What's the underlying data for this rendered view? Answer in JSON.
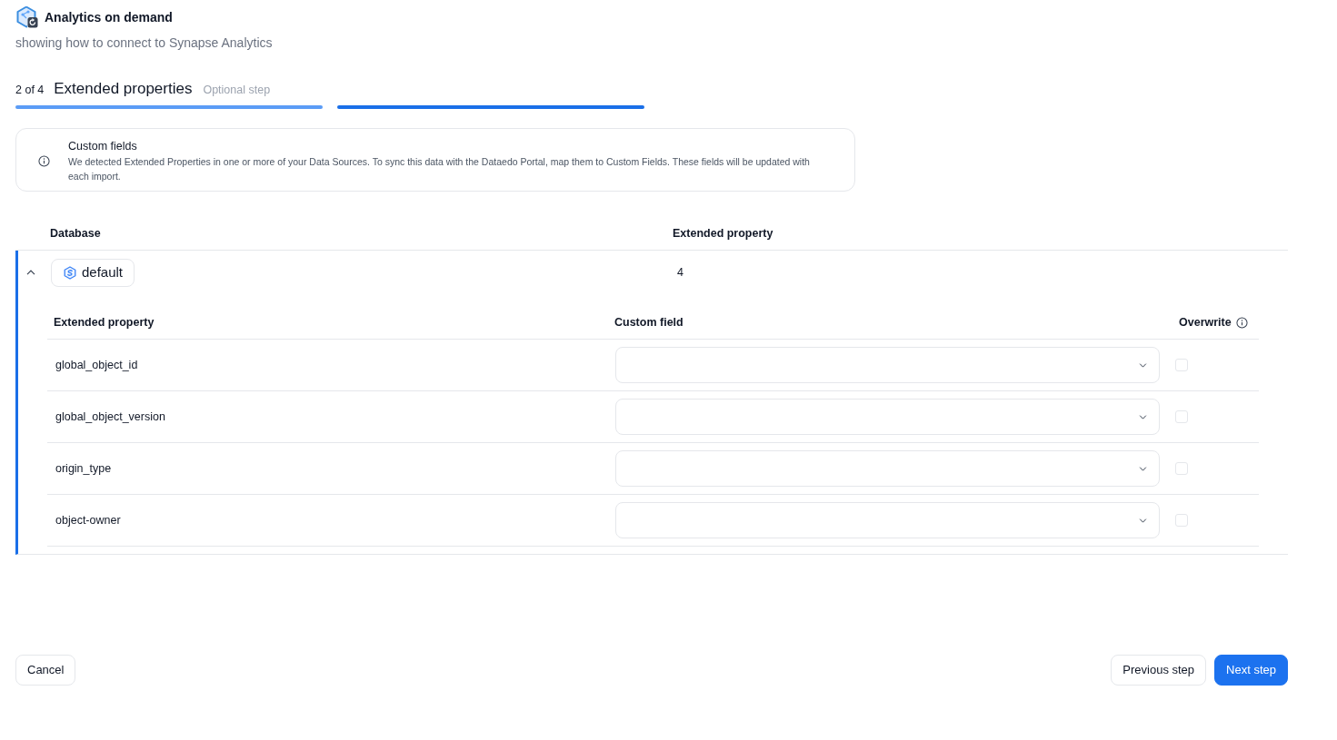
{
  "header": {
    "title": "Analytics on demand",
    "subtitle": "showing how to connect to Synapse Analytics"
  },
  "step": {
    "counter": "2 of 4",
    "title": "Extended properties",
    "note": "Optional step",
    "segments": [
      {
        "kind": "completed"
      },
      {
        "kind": "current"
      }
    ]
  },
  "notice": {
    "title": "Custom fields",
    "text": "We detected Extended Properties in one or more of your Data Sources. To sync this data with the Dataedo Portal, map them to Custom Fields. These fields will be updated with each import."
  },
  "table": {
    "columns": [
      "Database",
      "Extended property"
    ],
    "groups": [
      {
        "name": "default",
        "count": "4",
        "expanded": true,
        "columns": [
          {
            "label": "Extended property",
            "info": false
          },
          {
            "label": "Custom field",
            "info": false
          },
          {
            "label": "Overwrite",
            "info": true
          }
        ],
        "rows": [
          {
            "property": "global_object_id",
            "overwrite": false
          },
          {
            "property": "global_object_version",
            "overwrite": false
          },
          {
            "property": "origin_type",
            "overwrite": false
          },
          {
            "property": "object-owner",
            "overwrite": false
          }
        ]
      }
    ]
  },
  "footer": {
    "left_buttons": [
      {
        "label": "Cancel",
        "kind": "secondary"
      }
    ],
    "right_buttons": [
      {
        "label": "Previous step",
        "kind": "secondary"
      },
      {
        "label": "Next step",
        "kind": "primary"
      }
    ]
  }
}
